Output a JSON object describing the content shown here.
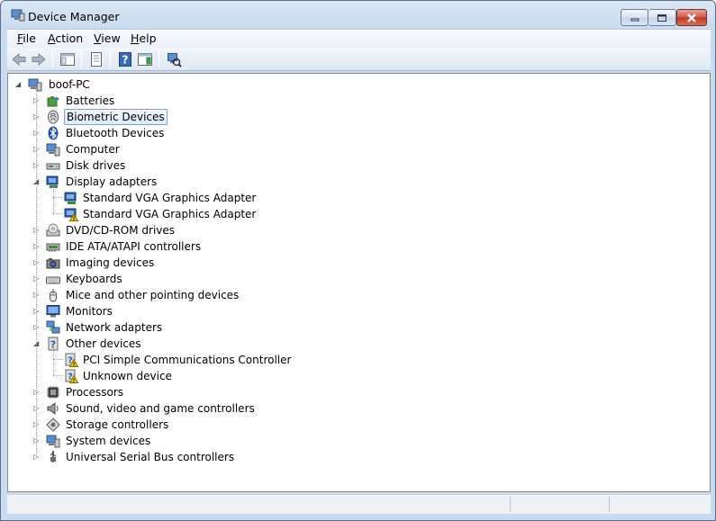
{
  "window": {
    "title": "Device Manager",
    "controls": {
      "minimize": "minimize-icon",
      "maximize": "maximize-icon",
      "close": "close-icon"
    }
  },
  "menu": {
    "items": [
      {
        "label": "File",
        "key": "F",
        "rest": "ile"
      },
      {
        "label": "Action",
        "key": "A",
        "rest": "ction"
      },
      {
        "label": "View",
        "key": "V",
        "rest": "iew"
      },
      {
        "label": "Help",
        "key": "H",
        "rest": "elp"
      }
    ]
  },
  "toolbar": {
    "buttons": [
      "back-icon",
      "forward-icon",
      "show-hide-console-tree-icon",
      "properties-icon",
      "help-icon",
      "show-action-pane-icon",
      "scan-hardware-changes-icon"
    ]
  },
  "tree": {
    "root": {
      "label": "boof-PC",
      "expanded": true
    },
    "categories": [
      {
        "label": "Batteries",
        "icon": "battery-icon",
        "expanded": false,
        "children": []
      },
      {
        "label": "Biometric Devices",
        "icon": "fingerprint-icon",
        "expanded": false,
        "selected": true,
        "children": []
      },
      {
        "label": "Bluetooth Devices",
        "icon": "bluetooth-icon",
        "expanded": false,
        "children": []
      },
      {
        "label": "Computer",
        "icon": "computer-icon",
        "expanded": false,
        "children": []
      },
      {
        "label": "Disk drives",
        "icon": "disk-drive-icon",
        "expanded": false,
        "children": []
      },
      {
        "label": "Display adapters",
        "icon": "display-adapter-icon",
        "expanded": true,
        "children": [
          {
            "label": "Standard VGA Graphics Adapter",
            "icon": "display-adapter-icon",
            "warning": false
          },
          {
            "label": "Standard VGA Graphics Adapter",
            "icon": "display-adapter-warning-icon",
            "warning": true
          }
        ]
      },
      {
        "label": "DVD/CD-ROM drives",
        "icon": "dvd-drive-icon",
        "expanded": false,
        "children": []
      },
      {
        "label": "IDE ATA/ATAPI controllers",
        "icon": "ide-controller-icon",
        "expanded": false,
        "children": []
      },
      {
        "label": "Imaging devices",
        "icon": "camera-icon",
        "expanded": false,
        "children": []
      },
      {
        "label": "Keyboards",
        "icon": "keyboard-icon",
        "expanded": false,
        "children": []
      },
      {
        "label": "Mice and other pointing devices",
        "icon": "mouse-icon",
        "expanded": false,
        "children": []
      },
      {
        "label": "Monitors",
        "icon": "monitor-icon",
        "expanded": false,
        "children": []
      },
      {
        "label": "Network adapters",
        "icon": "network-adapter-icon",
        "expanded": false,
        "children": []
      },
      {
        "label": "Other devices",
        "icon": "unknown-device-icon",
        "expanded": true,
        "children": [
          {
            "label": "PCI Simple Communications Controller",
            "icon": "unknown-device-warning-icon",
            "warning": true
          },
          {
            "label": "Unknown device",
            "icon": "unknown-device-warning-icon",
            "warning": true
          }
        ]
      },
      {
        "label": "Processors",
        "icon": "processor-icon",
        "expanded": false,
        "children": []
      },
      {
        "label": "Sound, video and game controllers",
        "icon": "speaker-icon",
        "expanded": false,
        "children": []
      },
      {
        "label": "Storage controllers",
        "icon": "storage-controller-icon",
        "expanded": false,
        "children": []
      },
      {
        "label": "System devices",
        "icon": "system-device-icon",
        "expanded": false,
        "children": []
      },
      {
        "label": "Universal Serial Bus controllers",
        "icon": "usb-icon",
        "expanded": false,
        "children": []
      }
    ]
  },
  "statusbar": {
    "text": ""
  },
  "colors": {
    "selection_border": "#7da2ce",
    "window_frame": "#c9dbef",
    "warning": "#f2c200"
  }
}
